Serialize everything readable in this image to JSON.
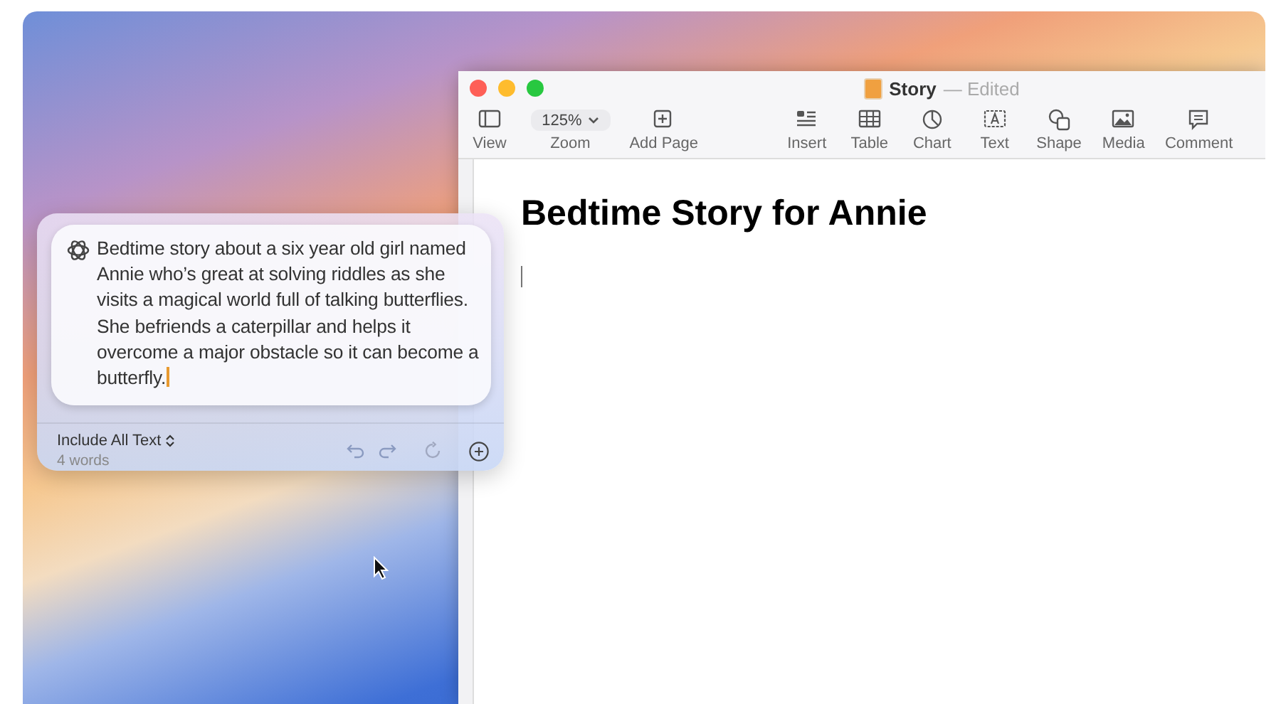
{
  "window": {
    "title": "Story",
    "status": "— Edited"
  },
  "toolbar": [
    {
      "kind": "button",
      "label": "View"
    },
    {
      "kind": "dropdown",
      "value": "125%",
      "label": "Zoom"
    },
    {
      "kind": "button",
      "label": "Add Page"
    },
    {
      "kind": "spacer"
    },
    {
      "kind": "button",
      "label": "Insert"
    },
    {
      "kind": "button",
      "label": "Table"
    },
    {
      "kind": "button",
      "label": "Chart"
    },
    {
      "kind": "button",
      "label": "Text"
    },
    {
      "kind": "button",
      "label": "Shape"
    },
    {
      "kind": "button",
      "label": "Media"
    },
    {
      "kind": "button",
      "label": "Comment"
    }
  ],
  "document": {
    "heading": "Bedtime Story for Annie"
  },
  "writing_popup": {
    "prompt": "Bedtime story about a six year old girl named Annie who’s great at solving riddles as she visits a magical world full of talking butterflies. She befriends a caterpillar and helps it overcome a major obstacle so it can become a butterfly.",
    "scope": "Include All Text",
    "word_count": "4 words"
  }
}
